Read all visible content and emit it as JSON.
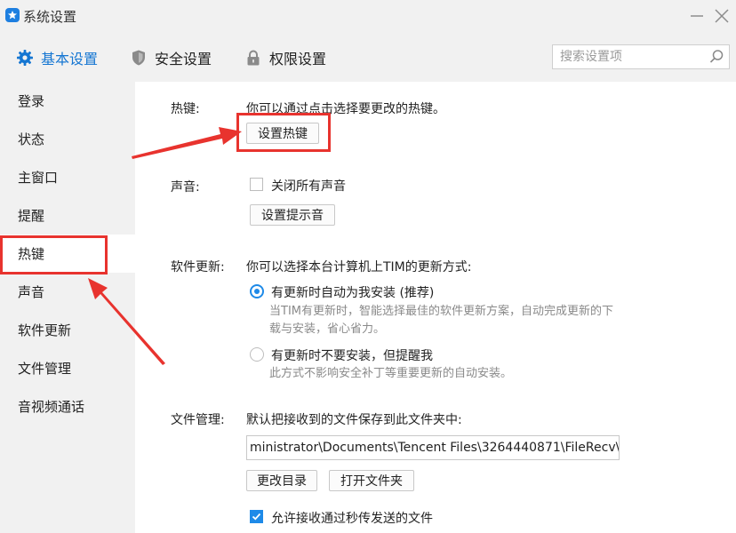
{
  "window": {
    "title": "系统设置"
  },
  "tabs": [
    {
      "label": "基本设置",
      "icon": "gear-icon",
      "active": true
    },
    {
      "label": "安全设置",
      "icon": "shield-icon",
      "active": false
    },
    {
      "label": "权限设置",
      "icon": "lock-icon",
      "active": false
    }
  ],
  "search": {
    "placeholder": "搜索设置项"
  },
  "sidebar": {
    "items": [
      {
        "label": "登录"
      },
      {
        "label": "状态"
      },
      {
        "label": "主窗口"
      },
      {
        "label": "提醒"
      },
      {
        "label": "热键",
        "active": true
      },
      {
        "label": "声音"
      },
      {
        "label": "软件更新"
      },
      {
        "label": "文件管理"
      },
      {
        "label": "音视频通话"
      }
    ]
  },
  "hotkey": {
    "label": "热键:",
    "desc": "你可以通过点击选择要更改的热键。",
    "button": "设置热键"
  },
  "sound": {
    "label": "声音:",
    "mute_all": "关闭所有声音",
    "mute_checked": false,
    "button": "设置提示音"
  },
  "update": {
    "label": "软件更新:",
    "desc": "你可以选择本台计算机上TIM的更新方式:",
    "options": [
      {
        "label": "有更新时自动为我安装 (推荐)",
        "desc_line1": "当TIM有更新时，智能选择最佳的软件更新方案，自动完成更新的下",
        "desc_line2": "载与安装，省心省力。",
        "selected": true
      },
      {
        "label": "有更新时不要安装，但提醒我",
        "desc_line1": "此方式不影响安全补丁等重要更新的自动安装。",
        "selected": false
      }
    ]
  },
  "files": {
    "label": "文件管理:",
    "desc": "默认把接收到的文件保存到此文件夹中:",
    "path": "ministrator\\Documents\\Tencent Files\\3264440871\\FileRecv\\",
    "change_button": "更改目录",
    "open_button": "打开文件夹",
    "allow_label": "允许接收通过秒传发送的文件",
    "allow_checked": true
  },
  "colors": {
    "accent": "#1576d2",
    "annotation": "#e8332e"
  }
}
